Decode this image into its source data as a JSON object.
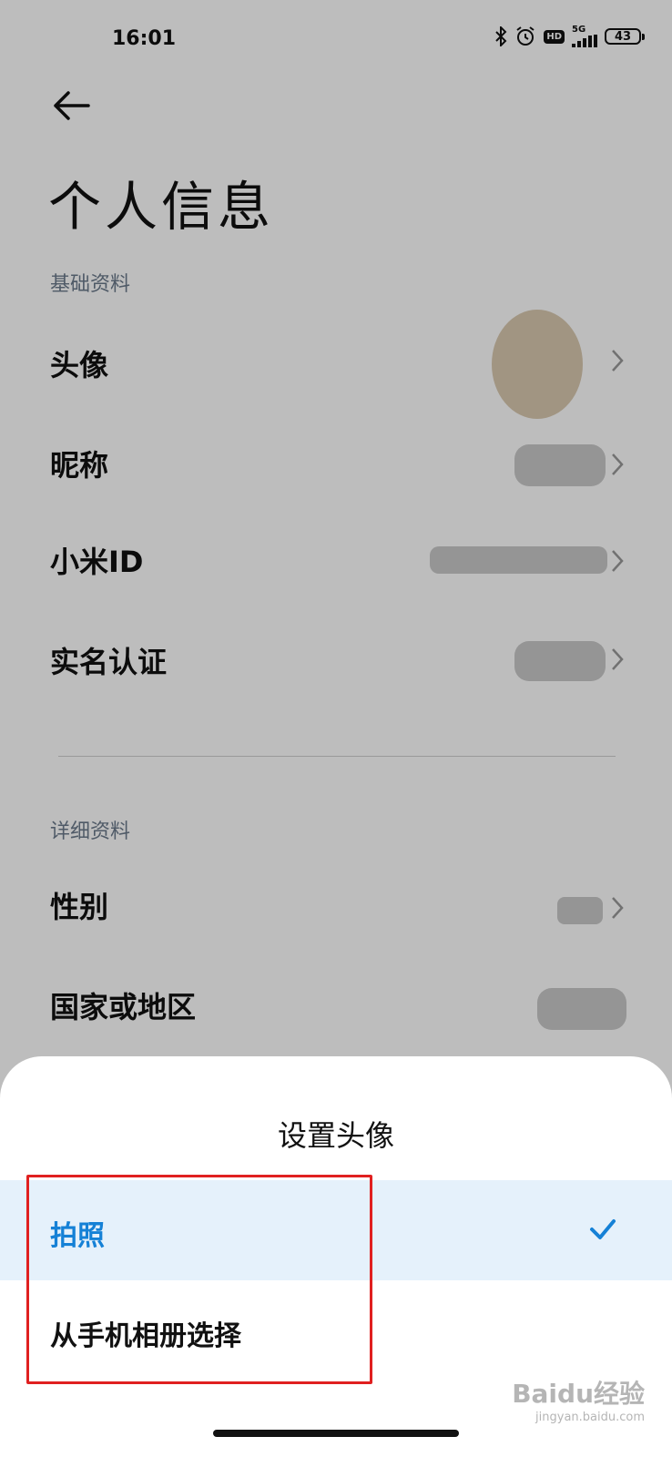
{
  "status_bar": {
    "time": "16:01",
    "hd_badge": "HD",
    "network": "5G",
    "battery": "43"
  },
  "page": {
    "title": "个人信息",
    "section_basic": "基础资料",
    "section_detail": "详细资料",
    "rows_basic": [
      {
        "label": "头像"
      },
      {
        "label": "昵称"
      },
      {
        "label": "小米ID"
      },
      {
        "label": "实名认证"
      }
    ],
    "rows_detail": [
      {
        "label": "性别"
      },
      {
        "label": "国家或地区"
      }
    ]
  },
  "sheet": {
    "title": "设置头像",
    "options": [
      {
        "label": "拍照",
        "selected": true
      },
      {
        "label": "从手机相册选择",
        "selected": false
      }
    ]
  },
  "watermark": {
    "brand": "Baidu经验",
    "url": "jingyan.baidu.com"
  },
  "colors": {
    "accent": "#1581d6",
    "selected_bg": "#e5f1fb",
    "highlight_box": "#e02020"
  }
}
